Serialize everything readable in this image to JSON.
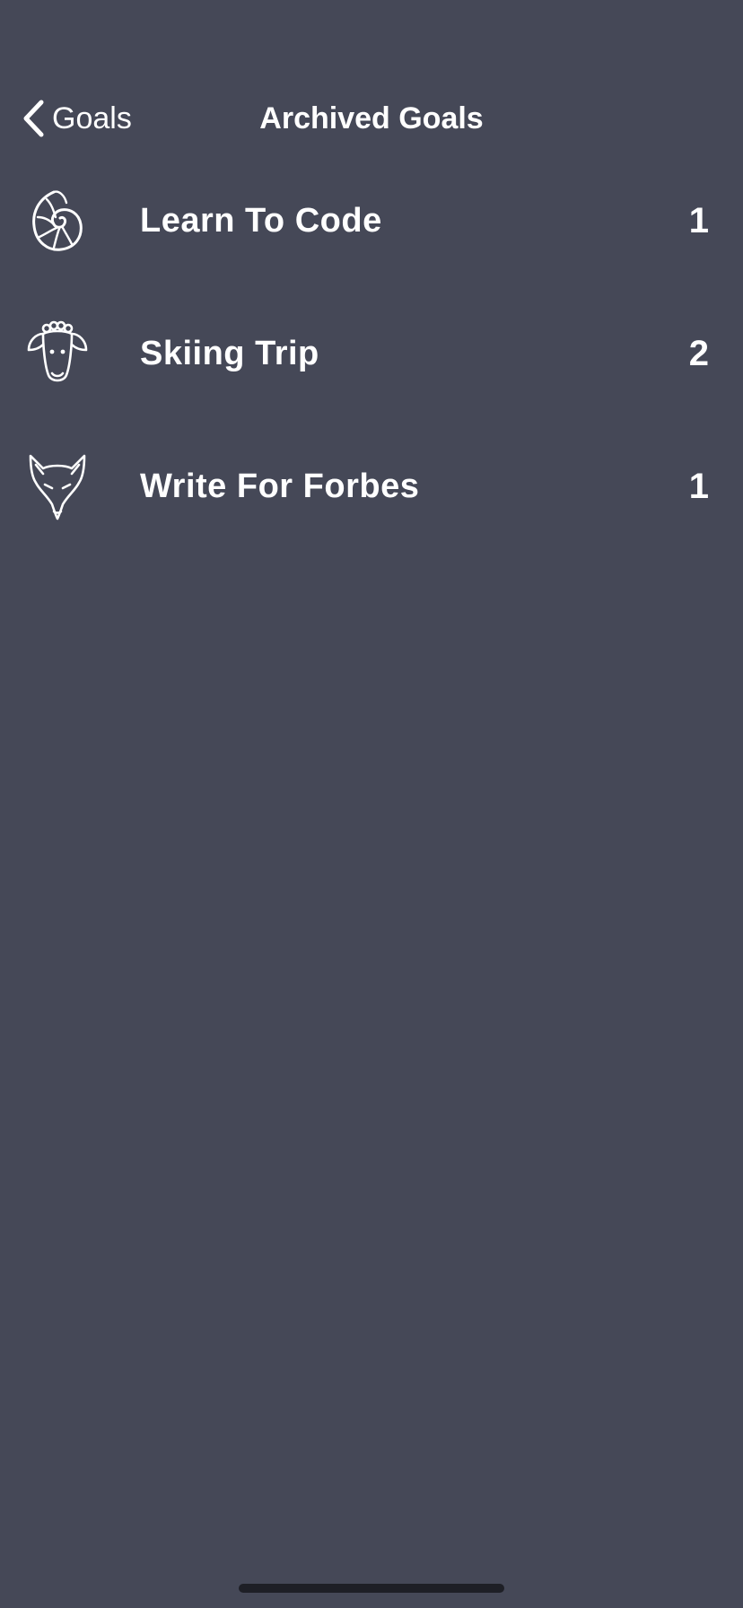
{
  "nav": {
    "back_label": "Goals",
    "title": "Archived Goals",
    "back_icon": "chevron-left-icon"
  },
  "goals": [
    {
      "name": "Learn To Code",
      "count": "1",
      "icon": "nautilus-shell-icon"
    },
    {
      "name": "Skiing Trip",
      "count": "2",
      "icon": "sheep-icon"
    },
    {
      "name": "Write For Forbes",
      "count": "1",
      "icon": "fox-icon"
    }
  ],
  "colors": {
    "background": "#454857",
    "text": "#ffffff",
    "home_indicator": "#1e1f26"
  }
}
